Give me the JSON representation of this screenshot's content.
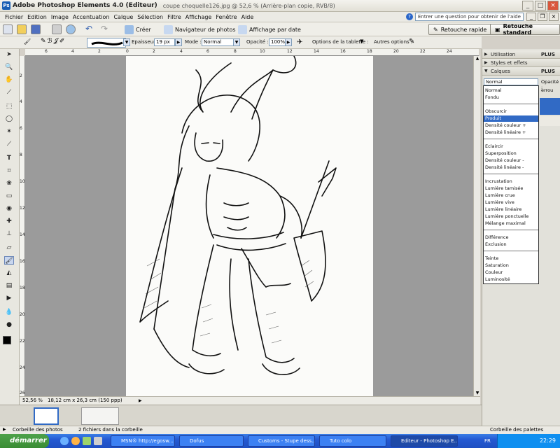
{
  "titlebar": {
    "app": "Adobe Photoshop Elements 4.0 (Editeur)",
    "doc": "coupe choquelle126.jpg @ 52,6 % (Arrière-plan copie, RVB/8)"
  },
  "menu": [
    "Fichier",
    "Edition",
    "Image",
    "Accentuation",
    "Calque",
    "Sélection",
    "Filtre",
    "Affichage",
    "Fenêtre",
    "Aide"
  ],
  "help_placeholder": "Entrer une question pour obtenir de l'aide",
  "shortcuts": {
    "create": "Créer",
    "navigator": "Navigateur de photos",
    "by_date": "Affichage par date",
    "quick_fix": "Retouche rapide",
    "standard_edit": "Retouche standard"
  },
  "options": {
    "thickness_label": "Epaisseur :",
    "thickness_value": "19 px",
    "mode_label": "Mode :",
    "mode_value": "Normal",
    "opacity_label": "Opacité :",
    "opacity_value": "100%",
    "tablet_label": "Options de la tablette :",
    "other_label": "Autres options :"
  },
  "ruler_top": [
    "6",
    "4",
    "2",
    "0",
    "2",
    "4",
    "6",
    "8",
    "10",
    "12",
    "14",
    "16",
    "18",
    "20",
    "22",
    "24"
  ],
  "ruler_left": [
    "2",
    "4",
    "6",
    "8",
    "10",
    "12",
    "14",
    "16",
    "18",
    "20",
    "22",
    "24",
    "26"
  ],
  "status": {
    "zoom": "52,56 %",
    "size": "18,12 cm x 26,3 cm (150 ppp)"
  },
  "palette": {
    "utilisation": "Utilisation",
    "styles": "Styles et effets",
    "calques": "Calques",
    "more": "PLUS",
    "blend_value": "Normal",
    "opacity_short": "Opacité :",
    "verrou": "errou"
  },
  "blend_modes": [
    [
      "Normal",
      "Fondu"
    ],
    [
      "Obscurcir",
      "Produit",
      "Densité couleur +",
      "Densité linéaire +"
    ],
    [
      "Eclaircir",
      "Superposition",
      "Densité couleur -",
      "Densité linéaire -"
    ],
    [
      "Incrustation",
      "Lumière tamisée",
      "Lumière crue",
      "Lumière vive",
      "Lumière linéaire",
      "Lumière ponctuelle",
      "Mélange maximal"
    ],
    [
      "Différence",
      "Exclusion"
    ],
    [
      "Teinte",
      "Saturation",
      "Couleur",
      "Luminosité"
    ]
  ],
  "blend_selected": "Produit",
  "bin": {
    "photos": "Corbeille des photos",
    "count": "2 fichiers dans la corbeille",
    "palettes": "Corbeille des palettes"
  },
  "taskbar": {
    "start": "démarrer",
    "tasks": [
      "MSN® http://egosw...",
      "Dofus",
      "Customs - Stupe dess...",
      "Tuto colo",
      "Editeur - Photoshop E..."
    ],
    "lang": "FR",
    "clock": "22:29"
  }
}
